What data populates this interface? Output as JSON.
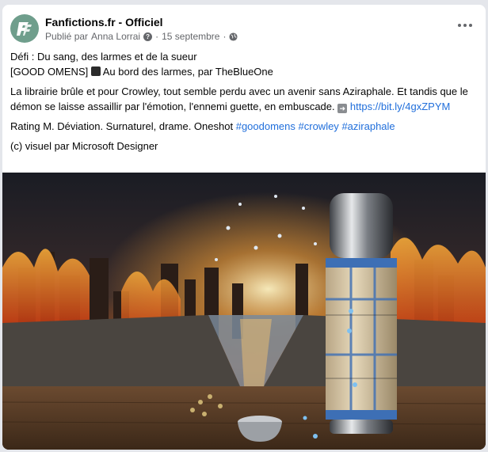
{
  "post": {
    "page_name": "Fanfictions.fr - Officiel",
    "published_by_prefix": "Publié par",
    "author": "Anna Lorrai",
    "separator": "·",
    "date": "15 septembre",
    "avatar_icon": "fanfictions-logo",
    "more_icon": "more-options-icon"
  },
  "content": {
    "line1": "Défi : Du sang, des larmes et de la sueur",
    "line2_prefix": "[GOOD OMENS]",
    "line2_icon": "black-square-icon",
    "line2_suffix": "Au bord des larmes, par TheBlueOne",
    "summary": "La librairie brûle et pour Crowley, tout semble perdu avec un avenir sans Aziraphale. Et tandis que le démon se laisse assaillir par l'émotion, l'ennemi guette, en embuscade.",
    "arrow_icon": "right-arrow-icon",
    "link": "https://bit.ly/4gxZPYM",
    "rating_text": "Rating M. Déviation. Surnaturel, drame. Oneshot",
    "tags": [
      "#goodomens",
      "#crowley",
      "#aziraphale"
    ],
    "credit": "(c) visuel par Microsoft Designer"
  },
  "colors": {
    "link": "#216fdb",
    "meta": "#65676b",
    "avatar": "#6f9e8c"
  }
}
